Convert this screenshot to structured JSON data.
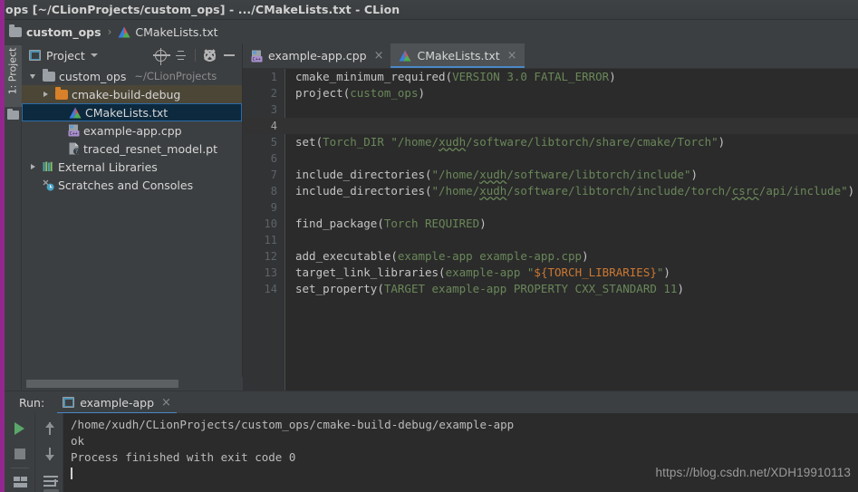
{
  "window": {
    "title": "ops [~/CLionProjects/custom_ops] - .../CMakeLists.txt - CLion"
  },
  "breadcrumb": {
    "project_label": "custom_ops",
    "separator": "›",
    "file_label": "CMakeLists.txt",
    "folder_icon": "folder-icon",
    "file_icon": "cmake-file-icon"
  },
  "left_strip": {
    "tool_label": "1: Project",
    "folder_icon": "folder-icon"
  },
  "project_panel": {
    "title": "Project",
    "title_icon": "project-window-icon",
    "dropdown_icon": "chevron-down-icon",
    "tools": [
      {
        "name": "locate-icon",
        "label": ""
      },
      {
        "name": "collapse-all-icon",
        "label": ""
      },
      {
        "name": "settings-gear-icon",
        "label": ""
      },
      {
        "name": "hide-panel-icon",
        "label": ""
      }
    ],
    "tree": [
      {
        "label": "custom_ops",
        "sub": "~/CLionProjects",
        "icon": "folder-icon",
        "twisty": "down",
        "indent": 0,
        "state": "normal"
      },
      {
        "label": "cmake-build-debug",
        "sub": "",
        "icon": "folder-orange-icon",
        "twisty": "right",
        "indent": 1,
        "state": "hover"
      },
      {
        "label": "CMakeLists.txt",
        "sub": "",
        "icon": "cmake-file-icon",
        "twisty": "none",
        "indent": 2,
        "state": "selected"
      },
      {
        "label": "example-app.cpp",
        "sub": "",
        "icon": "cpp-file-icon",
        "twisty": "none",
        "indent": 2,
        "state": "normal"
      },
      {
        "label": "traced_resnet_model.pt",
        "sub": "",
        "icon": "unknown-file-icon",
        "twisty": "none",
        "indent": 2,
        "state": "normal"
      },
      {
        "label": "External Libraries",
        "sub": "",
        "icon": "external-libraries-icon",
        "twisty": "right",
        "indent": 0,
        "state": "normal"
      },
      {
        "label": "Scratches and Consoles",
        "sub": "",
        "icon": "scratches-icon",
        "twisty": "none",
        "indent": 0,
        "state": "normal"
      }
    ]
  },
  "editor": {
    "tabs": [
      {
        "label": "example-app.cpp",
        "icon": "cpp-file-icon",
        "active": false,
        "close": "×"
      },
      {
        "label": "CMakeLists.txt",
        "icon": "cmake-file-icon",
        "active": true,
        "close": "×"
      }
    ],
    "current_line": 4,
    "lines": [
      {
        "n": "1",
        "tokens": [
          {
            "t": "cmake_minimum_required",
            "c": "fn"
          },
          {
            "t": "(",
            "c": "punct"
          },
          {
            "t": "VERSION 3.0 FATAL_ERROR",
            "c": "arg"
          },
          {
            "t": ")",
            "c": "punct"
          }
        ]
      },
      {
        "n": "2",
        "tokens": [
          {
            "t": "project",
            "c": "fn"
          },
          {
            "t": "(",
            "c": "punct"
          },
          {
            "t": "custom_ops",
            "c": "arg"
          },
          {
            "t": ")",
            "c": "punct"
          }
        ]
      },
      {
        "n": "3",
        "tokens": []
      },
      {
        "n": "4",
        "tokens": []
      },
      {
        "n": "5",
        "tokens": [
          {
            "t": "set",
            "c": "fn"
          },
          {
            "t": "(",
            "c": "punct"
          },
          {
            "t": "Torch_DIR ",
            "c": "arg"
          },
          {
            "t": "\"/home/",
            "c": "str"
          },
          {
            "t": "xudh",
            "c": "str-squig"
          },
          {
            "t": "/software/libtorch/share/cmake/Torch\"",
            "c": "str"
          },
          {
            "t": ")",
            "c": "punct"
          }
        ]
      },
      {
        "n": "6",
        "tokens": []
      },
      {
        "n": "7",
        "tokens": [
          {
            "t": "include_directories",
            "c": "fn"
          },
          {
            "t": "(",
            "c": "punct"
          },
          {
            "t": "\"/home/",
            "c": "str"
          },
          {
            "t": "xudh",
            "c": "str-squig"
          },
          {
            "t": "/software/libtorch/include\"",
            "c": "str"
          },
          {
            "t": ")",
            "c": "punct"
          }
        ]
      },
      {
        "n": "8",
        "tokens": [
          {
            "t": "include_directories",
            "c": "fn"
          },
          {
            "t": "(",
            "c": "punct"
          },
          {
            "t": "\"/home/",
            "c": "str"
          },
          {
            "t": "xudh",
            "c": "str-squig"
          },
          {
            "t": "/software/libtorch/include/torch/",
            "c": "str"
          },
          {
            "t": "csrc",
            "c": "str-squig"
          },
          {
            "t": "/api/include\"",
            "c": "str"
          },
          {
            "t": ")",
            "c": "punct"
          }
        ]
      },
      {
        "n": "9",
        "tokens": []
      },
      {
        "n": "10",
        "tokens": [
          {
            "t": "find_package",
            "c": "fn"
          },
          {
            "t": "(",
            "c": "punct"
          },
          {
            "t": "Torch REQUIRED",
            "c": "arg"
          },
          {
            "t": ")",
            "c": "punct"
          }
        ]
      },
      {
        "n": "11",
        "tokens": []
      },
      {
        "n": "12",
        "tokens": [
          {
            "t": "add_executable",
            "c": "fn"
          },
          {
            "t": "(",
            "c": "punct"
          },
          {
            "t": "example-app example-app.cpp",
            "c": "arg"
          },
          {
            "t": ")",
            "c": "punct"
          }
        ]
      },
      {
        "n": "13",
        "tokens": [
          {
            "t": "target_link_libraries",
            "c": "fn"
          },
          {
            "t": "(",
            "c": "punct"
          },
          {
            "t": "example-app ",
            "c": "arg"
          },
          {
            "t": "\"",
            "c": "str"
          },
          {
            "t": "${TORCH_LIBRARIES}",
            "c": "var"
          },
          {
            "t": "\"",
            "c": "str"
          },
          {
            "t": ")",
            "c": "punct"
          }
        ]
      },
      {
        "n": "14",
        "tokens": [
          {
            "t": "set_property",
            "c": "fn"
          },
          {
            "t": "(",
            "c": "punct"
          },
          {
            "t": "TARGET example-app PROPERTY CXX_STANDARD 11",
            "c": "arg"
          },
          {
            "t": ")",
            "c": "punct"
          }
        ]
      }
    ]
  },
  "run_panel": {
    "title": "Run:",
    "tab": {
      "label": "example-app",
      "icon": "run-config-icon",
      "close": "×"
    },
    "toolbar": [
      {
        "name": "rerun-button-icon",
        "color": "#59a869"
      },
      {
        "name": "stop-button-icon",
        "color": "#7b7f81"
      },
      {
        "name": "layout-toggle-icon",
        "color": "#9aa0a6"
      },
      {
        "name": "scroll-up-icon",
        "color": "#8e9294"
      },
      {
        "name": "scroll-down-icon",
        "color": "#8e9294"
      },
      {
        "name": "soft-wrap-icon",
        "color": "#9aa0a6"
      }
    ],
    "console": [
      "/home/xudh/CLionProjects/custom_ops/cmake-build-debug/example-app",
      "ok",
      "",
      "Process finished with exit code 0"
    ],
    "watermark": "https://blog.csdn.net/XDH19910113"
  },
  "colors": {
    "accent_blue": "#4a88c7",
    "panel_bg": "#3c3f41",
    "editor_bg": "#2b2b2b",
    "gutter_bg": "#313335",
    "string_green": "#6a8759",
    "variable_orange": "#cc7832",
    "edge_magenta": "#93278f",
    "selection_navy": "#0d293e",
    "run_play_green": "#59a869"
  }
}
